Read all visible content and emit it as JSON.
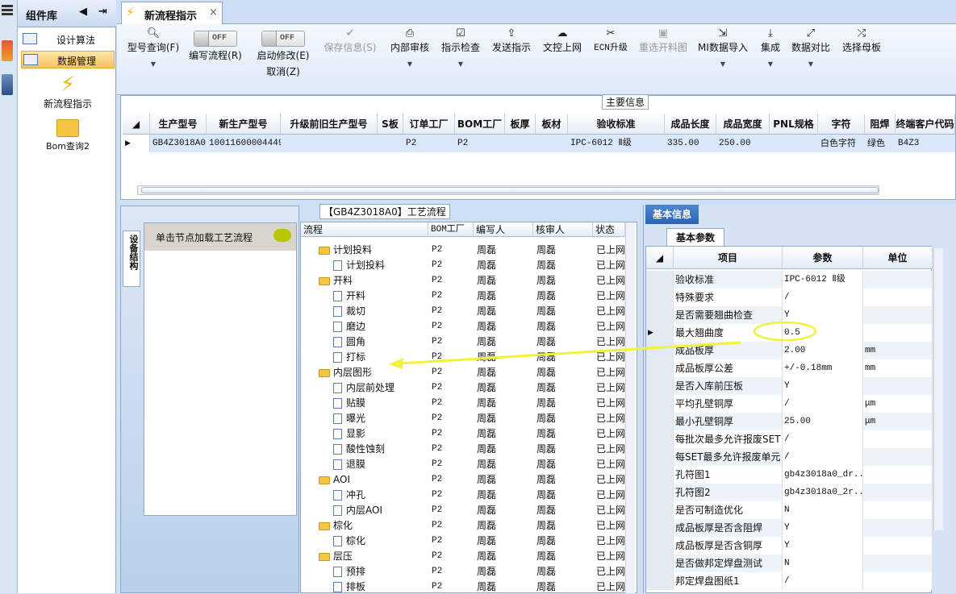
{
  "sidebar": {
    "title": "组件库",
    "items": [
      {
        "label": "设计算法"
      },
      {
        "label": "数据管理"
      }
    ],
    "tools": [
      {
        "label": "新流程指示",
        "icon": "lightning-icon"
      },
      {
        "label": "Bom查询2",
        "icon": "folder-icon"
      }
    ]
  },
  "tab": {
    "title": "新流程指示",
    "close": "×"
  },
  "toolbar": {
    "model_query": "型号查询(F)",
    "edit_flow": "编写流程(R)",
    "start_modify": "启动修改(E)",
    "cancel": "取消(Z)",
    "off": "OFF",
    "save": "保存信息(S)",
    "internal_review": "内部审核",
    "check": "指示检查",
    "send": "发送指示",
    "upload": "文控上网",
    "ecn": "ECN升级",
    "reselect": "重选开料图",
    "mi_import": "MI数据导入",
    "integrate": "集成",
    "compare": "数据对比",
    "select_mother": "选择母板"
  },
  "main_info": {
    "label": "主要信息",
    "columns": [
      "生产型号",
      "新生产型号",
      "升级前旧生产型号",
      "S板",
      "订单工厂",
      "BOM工厂",
      "板厚",
      "板材",
      "验收标准",
      "成品长度",
      "成品宽度",
      "PNL规格",
      "字符",
      "阻焊",
      "终端客户代码"
    ],
    "row": [
      "GB4Z3018A0",
      "10011600004449",
      "",
      "",
      "P2",
      "P2",
      "",
      "",
      "IPC-6012 Ⅱ级",
      "335.00",
      "250.00",
      "",
      "白色字符",
      "绿色",
      "B4Z3"
    ]
  },
  "process": {
    "title": "【GB4Z3018A0】工艺流程",
    "side_tab": "设备结构",
    "hint": "单击节点加载工艺流程",
    "columns": [
      "流程",
      "BOM工厂",
      "编写人",
      "核审人",
      "状态"
    ],
    "rows": [
      {
        "name": "计划投料",
        "level": 0,
        "factory": "P2",
        "writer": "周磊",
        "reviewer": "周磊",
        "status": "已上网"
      },
      {
        "name": "计划投料",
        "level": 1,
        "factory": "P2",
        "writer": "周磊",
        "reviewer": "周磊",
        "status": "已上网"
      },
      {
        "name": "开料",
        "level": 0,
        "factory": "P2",
        "writer": "周磊",
        "reviewer": "周磊",
        "status": "已上网"
      },
      {
        "name": "开料",
        "level": 1,
        "factory": "P2",
        "writer": "周磊",
        "reviewer": "周磊",
        "status": "已上网"
      },
      {
        "name": "裁切",
        "level": 1,
        "factory": "P2",
        "writer": "周磊",
        "reviewer": "周磊",
        "status": "已上网"
      },
      {
        "name": "磨边",
        "level": 1,
        "factory": "P2",
        "writer": "周磊",
        "reviewer": "周磊",
        "status": "已上网"
      },
      {
        "name": "圆角",
        "level": 1,
        "factory": "P2",
        "writer": "周磊",
        "reviewer": "周磊",
        "status": "已上网"
      },
      {
        "name": "打标",
        "level": 1,
        "factory": "P2",
        "writer": "周磊",
        "reviewer": "周磊",
        "status": "已上网"
      },
      {
        "name": "内层图形",
        "level": 0,
        "factory": "P2",
        "writer": "周磊",
        "reviewer": "周磊",
        "status": "已上网"
      },
      {
        "name": "内层前处理",
        "level": 1,
        "factory": "P2",
        "writer": "周磊",
        "reviewer": "周磊",
        "status": "已上网"
      },
      {
        "name": "贴膜",
        "level": 1,
        "factory": "P2",
        "writer": "周磊",
        "reviewer": "周磊",
        "status": "已上网"
      },
      {
        "name": "曝光",
        "level": 1,
        "factory": "P2",
        "writer": "周磊",
        "reviewer": "周磊",
        "status": "已上网"
      },
      {
        "name": "显影",
        "level": 1,
        "factory": "P2",
        "writer": "周磊",
        "reviewer": "周磊",
        "status": "已上网"
      },
      {
        "name": "酸性蚀刻",
        "level": 1,
        "factory": "P2",
        "writer": "周磊",
        "reviewer": "周磊",
        "status": "已上网"
      },
      {
        "name": "退膜",
        "level": 1,
        "factory": "P2",
        "writer": "周磊",
        "reviewer": "周磊",
        "status": "已上网"
      },
      {
        "name": "AOI",
        "level": 0,
        "factory": "P2",
        "writer": "周磊",
        "reviewer": "周磊",
        "status": "已上网"
      },
      {
        "name": "冲孔",
        "level": 1,
        "factory": "P2",
        "writer": "周磊",
        "reviewer": "周磊",
        "status": "已上网"
      },
      {
        "name": "内层AOI",
        "level": 1,
        "factory": "P2",
        "writer": "周磊",
        "reviewer": "周磊",
        "status": "已上网"
      },
      {
        "name": "棕化",
        "level": 0,
        "factory": "P2",
        "writer": "周磊",
        "reviewer": "周磊",
        "status": "已上网"
      },
      {
        "name": "棕化",
        "level": 1,
        "factory": "P2",
        "writer": "周磊",
        "reviewer": "周磊",
        "status": "已上网"
      },
      {
        "name": "层压",
        "level": 0,
        "factory": "P2",
        "writer": "周磊",
        "reviewer": "周磊",
        "status": "已上网"
      },
      {
        "name": "预排",
        "level": 1,
        "factory": "P2",
        "writer": "周磊",
        "reviewer": "周磊",
        "status": "已上网"
      },
      {
        "name": "排板",
        "level": 1,
        "factory": "P2",
        "writer": "周磊",
        "reviewer": "周磊",
        "status": "已上网"
      }
    ]
  },
  "basic_info": {
    "tab": "基本信息",
    "subtab": "基本参数",
    "columns": [
      "项目",
      "参数",
      "单位"
    ],
    "rows": [
      {
        "item": "验收标准",
        "value": "IPC-6012 Ⅱ级",
        "unit": ""
      },
      {
        "item": "特殊要求",
        "value": "/",
        "unit": ""
      },
      {
        "item": "是否需要翘曲检查",
        "value": "Y",
        "unit": ""
      },
      {
        "item": "最大翘曲度",
        "value": "0.5",
        "unit": ""
      },
      {
        "item": "成品板厚",
        "value": "2.00",
        "unit": "mm"
      },
      {
        "item": "成品板厚公差",
        "value": "+/-0.18mm",
        "unit": "mm"
      },
      {
        "item": "是否入库前压板",
        "value": "Y",
        "unit": ""
      },
      {
        "item": "平均孔壁铜厚",
        "value": "/",
        "unit": "μm"
      },
      {
        "item": "最小孔壁铜厚",
        "value": "25.00",
        "unit": "μm"
      },
      {
        "item": "每批次最多允许报废SET",
        "value": "/",
        "unit": ""
      },
      {
        "item": "每SET最多允许报废单元",
        "value": "/",
        "unit": ""
      },
      {
        "item": "孔符图1",
        "value": "gb4z3018a0_dr...",
        "unit": ""
      },
      {
        "item": "孔符图2",
        "value": "gb4z3018a0_2r...",
        "unit": ""
      },
      {
        "item": "是否可制造优化",
        "value": "N",
        "unit": ""
      },
      {
        "item": "成品板厚是否含阻焊",
        "value": "Y",
        "unit": ""
      },
      {
        "item": "成品板厚是否含铜厚",
        "value": "Y",
        "unit": ""
      },
      {
        "item": "是否做邦定焊盘测试",
        "value": "N",
        "unit": ""
      },
      {
        "item": "邦定焊盘图纸1",
        "value": "/",
        "unit": ""
      }
    ]
  },
  "colors": {
    "accent": "#2b64b5",
    "highlight": "#f8c25c",
    "annotation": "#f2f23a"
  }
}
